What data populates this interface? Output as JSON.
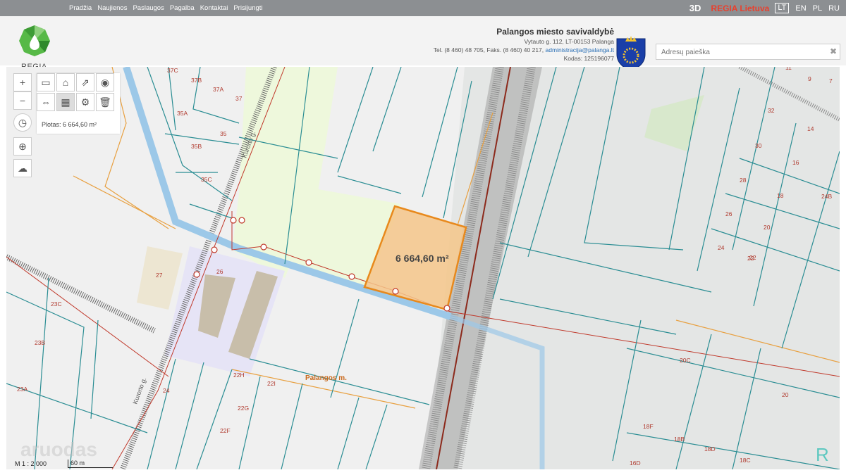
{
  "topnav": {
    "items": [
      "Pradžia",
      "Naujienos",
      "Paslaugos",
      "Pagalba",
      "Kontaktai",
      "Prisijungti"
    ]
  },
  "topright": {
    "btn_3d": "3D",
    "regia_link": "REGIA Lietuva",
    "languages": [
      "LT",
      "EN",
      "PL",
      "RU"
    ],
    "active_language": "LT"
  },
  "header": {
    "logo_text": "REGIA",
    "municipality_name": "Palangos miesto savivaldybė",
    "address": "Vytauto g. 112, LT-00153 Palanga",
    "phone_prefix": "Tel. (8 460) 48 705, Faks. (8 460) 40 217,",
    "email": "administracija@palanga.lt",
    "code": "Kodas: 125196077"
  },
  "search": {
    "placeholder": "Adresų paieška",
    "clear_icon": "close-icon"
  },
  "map": {
    "area_label": "Plotas: 6 664,60 m²",
    "parcel_area": "6 664,60 m²",
    "scale": "M 1 : 2 000",
    "scale_bar": "60 m",
    "town_label": "Palangos m.",
    "street_labels": [
      "Kurorto g.",
      "Kurorto g."
    ],
    "watermark": "aruodas",
    "parcel_labels": [
      "37C",
      "37B",
      "37A",
      "37",
      "35A",
      "35",
      "35B",
      "35C",
      "27",
      "26",
      "23C",
      "23B",
      "23A",
      "24",
      "22H",
      "22I",
      "22G",
      "22F",
      "22",
      "11",
      "9",
      "7",
      "32",
      "14",
      "30",
      "16",
      "28",
      "18",
      "24B",
      "26",
      "20",
      "24",
      "22",
      "20C",
      "20",
      "18F",
      "18B",
      "18D",
      "16D",
      "18C"
    ],
    "colors": {
      "parcel_line": "#2a8d93",
      "selected_fill": "#f5c58a",
      "selected_border": "#e8891c",
      "water": "#9cc8e8",
      "red_line": "#c0392b",
      "green_zone": "#eef8dc",
      "building_zone": "#e6e4f6",
      "boundary": "#8c2a1c"
    }
  }
}
